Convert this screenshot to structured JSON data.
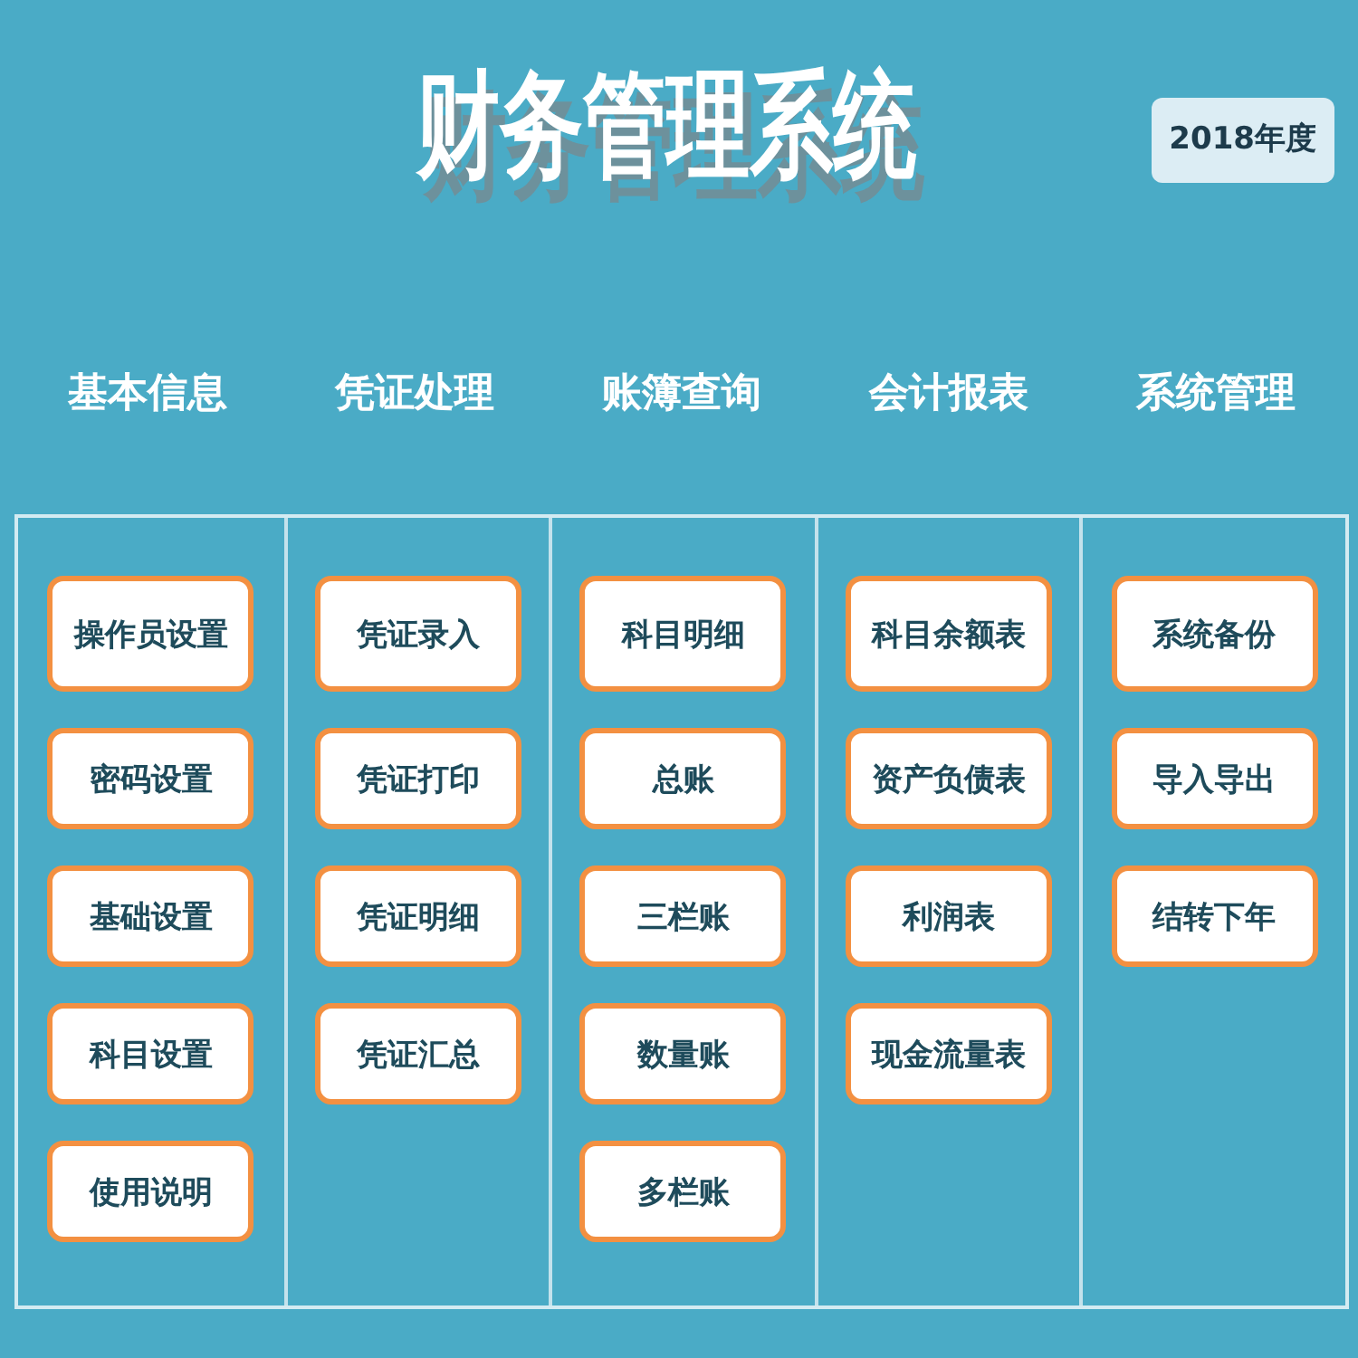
{
  "title": "财务管理系统",
  "year_badge": "2018年度",
  "columns": [
    {
      "heading": "基本信息",
      "items": [
        "操作员设置",
        "密码设置",
        "基础设置",
        "科目设置",
        "使用说明"
      ]
    },
    {
      "heading": "凭证处理",
      "items": [
        "凭证录入",
        "凭证打印",
        "凭证明细",
        "凭证汇总"
      ]
    },
    {
      "heading": "账簿查询",
      "items": [
        "科目明细",
        "总账",
        "三栏账",
        "数量账",
        "多栏账"
      ]
    },
    {
      "heading": "会计报表",
      "items": [
        "科目余额表",
        "资产负债表",
        "利润表",
        "现金流量表"
      ]
    },
    {
      "heading": "系统管理",
      "items": [
        "系统备份",
        "导入导出",
        "结转下年"
      ]
    }
  ]
}
